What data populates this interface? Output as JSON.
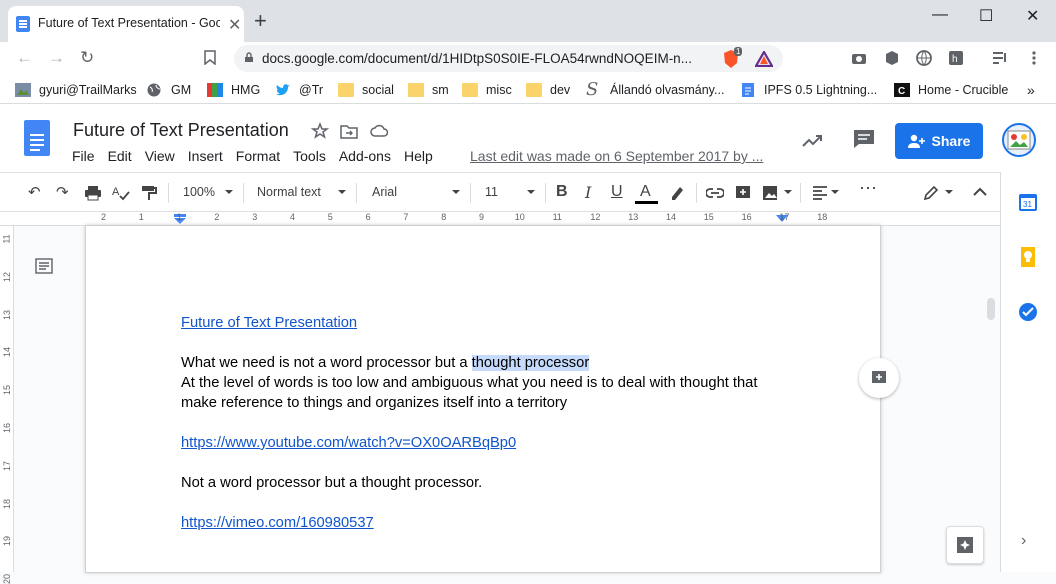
{
  "browser": {
    "tab_title": "Future of Text Presentation - Goog",
    "url": "docs.google.com/document/d/1HIDtpS0S0IE-FLOA54rwndNOQEIM-n...",
    "brave_badge": "1",
    "window": {
      "minimize": "—",
      "maximize": "☐",
      "close": "✕"
    }
  },
  "bookmarks": [
    {
      "label": "gyuri@TrailMarks",
      "icon": "trailmarks-icon"
    },
    {
      "label": "GM",
      "icon": "globe-icon"
    },
    {
      "label": "HMG",
      "icon": "hmg-icon"
    },
    {
      "label": "@Tr",
      "icon": "twitter-icon"
    },
    {
      "label": "social",
      "icon": "folder-icon"
    },
    {
      "label": "sm",
      "icon": "folder-icon"
    },
    {
      "label": "misc",
      "icon": "folder-icon"
    },
    {
      "label": "dev",
      "icon": "folder-icon"
    },
    {
      "label": "Állandó olvasmány...",
      "icon": "s-icon"
    },
    {
      "label": "IPFS 0.5 Lightning...",
      "icon": "docs-icon"
    },
    {
      "label": "Home - Crucible",
      "icon": "crucible-icon"
    }
  ],
  "docs": {
    "title": "Future of Text Presentation",
    "menu": [
      "File",
      "Edit",
      "View",
      "Insert",
      "Format",
      "Tools",
      "Add-ons",
      "Help"
    ],
    "last_edit": "Last edit was made on 6 September 2017 by ...",
    "share_label": "Share"
  },
  "toolbar": {
    "zoom": "100%",
    "style": "Normal text",
    "font": "Arial",
    "size": "11"
  },
  "ruler": {
    "h_labels": [
      "2",
      "1",
      "1",
      "2",
      "3",
      "4",
      "5",
      "6",
      "7",
      "8",
      "9",
      "10",
      "11",
      "12",
      "13",
      "14",
      "15",
      "16",
      "17",
      "18"
    ],
    "v_labels": [
      "11",
      "12",
      "13",
      "14",
      "15",
      "16",
      "17",
      "18",
      "19",
      "20"
    ]
  },
  "document": {
    "heading_link": "Future of Text Presentation",
    "line1_before": "What we need is not a word processor but a ",
    "line1_selected": "thought processor",
    "line2": "At the level of words is too low and ambiguous what you need is to deal with thought that",
    "line3": "make reference to things and organizes itself into a territory",
    "youtube_link": "https://www.youtube.com/watch?v=OX0OARBqBp0",
    "line4": "Not a word processor but a thought processor.",
    "vimeo_link": "https://vimeo.com/160980537"
  },
  "colors": {
    "accent": "#1a73e8",
    "link": "#1155cc",
    "selection": "#c6dafc"
  }
}
